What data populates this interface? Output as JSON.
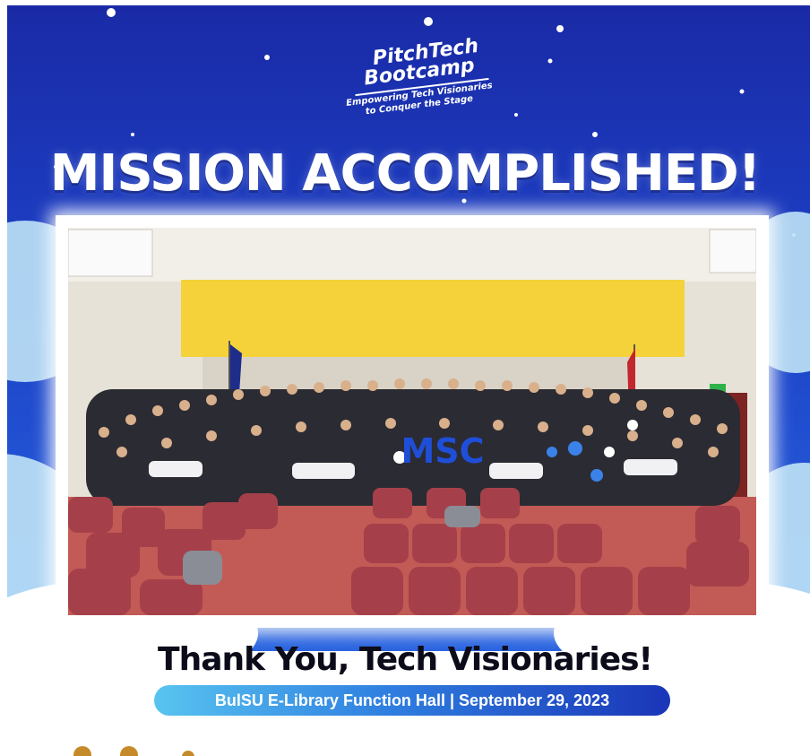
{
  "logo": {
    "line1": "PitchTech",
    "line2": "Bootcamp",
    "tagline1": "Empowering Tech Visionaries",
    "tagline2": "to Conquer the Stage"
  },
  "headline": "MISSION ACCOMPLISHED!",
  "photo": {
    "banner_text": "MSC"
  },
  "thanks_text": "Thank You, Tech Visionaries!",
  "venue_text": "BulSU E-Library Function Hall | September 29, 2023",
  "colors": {
    "sky_top": "#1a2aa6",
    "sky_bottom": "#2763e0",
    "cloud": "#bfe3f6",
    "pill_start": "#58c4f0",
    "pill_end": "#1a35b8",
    "yellow_panel": "#f5d23a",
    "carpet": "#c25a55"
  }
}
